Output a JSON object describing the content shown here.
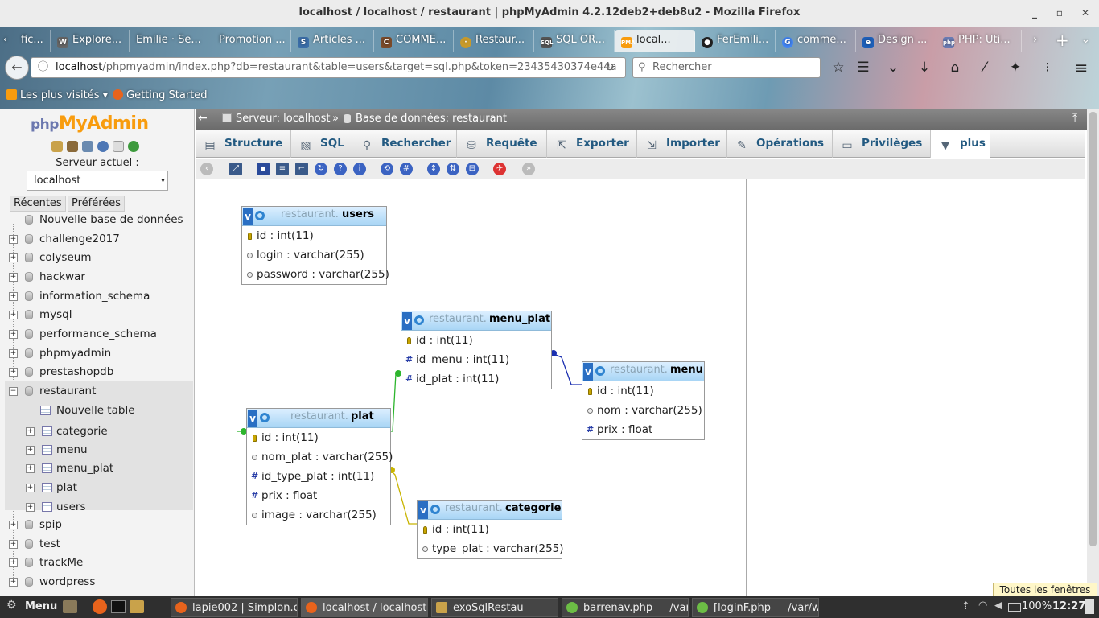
{
  "window": {
    "title": "localhost / localhost / restaurant | phpMyAdmin 4.2.12deb2+deb8u2 - Mozilla Firefox"
  },
  "browser": {
    "tabs": [
      {
        "label": "fic..."
      },
      {
        "label": "Explore..."
      },
      {
        "label": "Emilie · Se..."
      },
      {
        "label": "Promotion ..."
      },
      {
        "label": "Articles ..."
      },
      {
        "label": "COMME..."
      },
      {
        "label": "Restaur..."
      },
      {
        "label": "SQL OR..."
      },
      {
        "label": "local..."
      },
      {
        "label": "FerEmili..."
      },
      {
        "label": "comme..."
      },
      {
        "label": "Design ..."
      },
      {
        "label": "PHP: Uti..."
      }
    ],
    "url_host": "localhost",
    "url_rest": "/phpmyadmin/index.php?db=restaurant&table=users&target=sql.php&token=23435430374e44a",
    "search_placeholder": "Rechercher",
    "bookmarks": {
      "most_visited": "Les plus visités",
      "getting_started": "Getting Started"
    }
  },
  "sidebar": {
    "logo_php": "php",
    "logo_myadmin": "MyAdmin",
    "server_label": "Serveur actuel :",
    "server_value": "localhost",
    "tab_recent": "Récentes",
    "tab_favorites": "Préférées",
    "new_db": "Nouvelle base de données",
    "databases_top": [
      "challenge2017",
      "colyseum",
      "hackwar",
      "information_schema",
      "mysql",
      "performance_schema",
      "phpmyadmin",
      "prestashopdb"
    ],
    "current_db": "restaurant",
    "new_table": "Nouvelle table",
    "tables": [
      "categorie",
      "menu",
      "menu_plat",
      "plat",
      "users"
    ],
    "databases_bottom": [
      "spip",
      "test",
      "trackMe",
      "wordpress"
    ]
  },
  "breadcrumb": {
    "server": "Serveur: localhost",
    "sep": "»",
    "database": "Base de données: restaurant"
  },
  "menu": [
    "Structure",
    "SQL",
    "Rechercher",
    "Requête",
    "Exporter",
    "Importer",
    "Opérations",
    "Privilèges",
    "plus"
  ],
  "designer": {
    "db_prefix": "restaurant.",
    "tables": {
      "users": {
        "name": "users",
        "columns": [
          {
            "text": "id : int(11)",
            "kind": "pk"
          },
          {
            "text": "login : varchar(255)",
            "kind": "col"
          },
          {
            "text": "password : varchar(255)",
            "kind": "col"
          }
        ]
      },
      "menu_plat": {
        "name": "menu_plat",
        "columns": [
          {
            "text": "id : int(11)",
            "kind": "pk"
          },
          {
            "text": "id_menu : int(11)",
            "kind": "num"
          },
          {
            "text": "id_plat : int(11)",
            "kind": "num"
          }
        ]
      },
      "menu": {
        "name": "menu",
        "columns": [
          {
            "text": "id : int(11)",
            "kind": "pk"
          },
          {
            "text": "nom : varchar(255)",
            "kind": "col"
          },
          {
            "text": "prix : float",
            "kind": "num"
          }
        ]
      },
      "plat": {
        "name": "plat",
        "columns": [
          {
            "text": "id : int(11)",
            "kind": "pk"
          },
          {
            "text": "nom_plat : varchar(255)",
            "kind": "col"
          },
          {
            "text": "id_type_plat : int(11)",
            "kind": "num"
          },
          {
            "text": "prix : float",
            "kind": "num"
          },
          {
            "text": "image : varchar(255)",
            "kind": "col"
          }
        ]
      },
      "categorie": {
        "name": "categorie",
        "columns": [
          {
            "text": "id : int(11)",
            "kind": "pk"
          },
          {
            "text": "type_plat : varchar(255)",
            "kind": "col"
          }
        ]
      }
    },
    "relation_colors": {
      "menu": "#1a2fb0",
      "plat": "#2db52d",
      "categorie": "#c8b400"
    }
  },
  "toutes_fenetres": "Toutes les fenêtres",
  "taskbar": {
    "menu": "Menu",
    "tasks": [
      "lapie002 | Simplon.c...",
      "localhost / localhost ...",
      "exoSqlRestau",
      "barrenav.php — /var...",
      "[loginF.php — /var/w..."
    ],
    "battery": "100%",
    "clock": "12:27"
  }
}
